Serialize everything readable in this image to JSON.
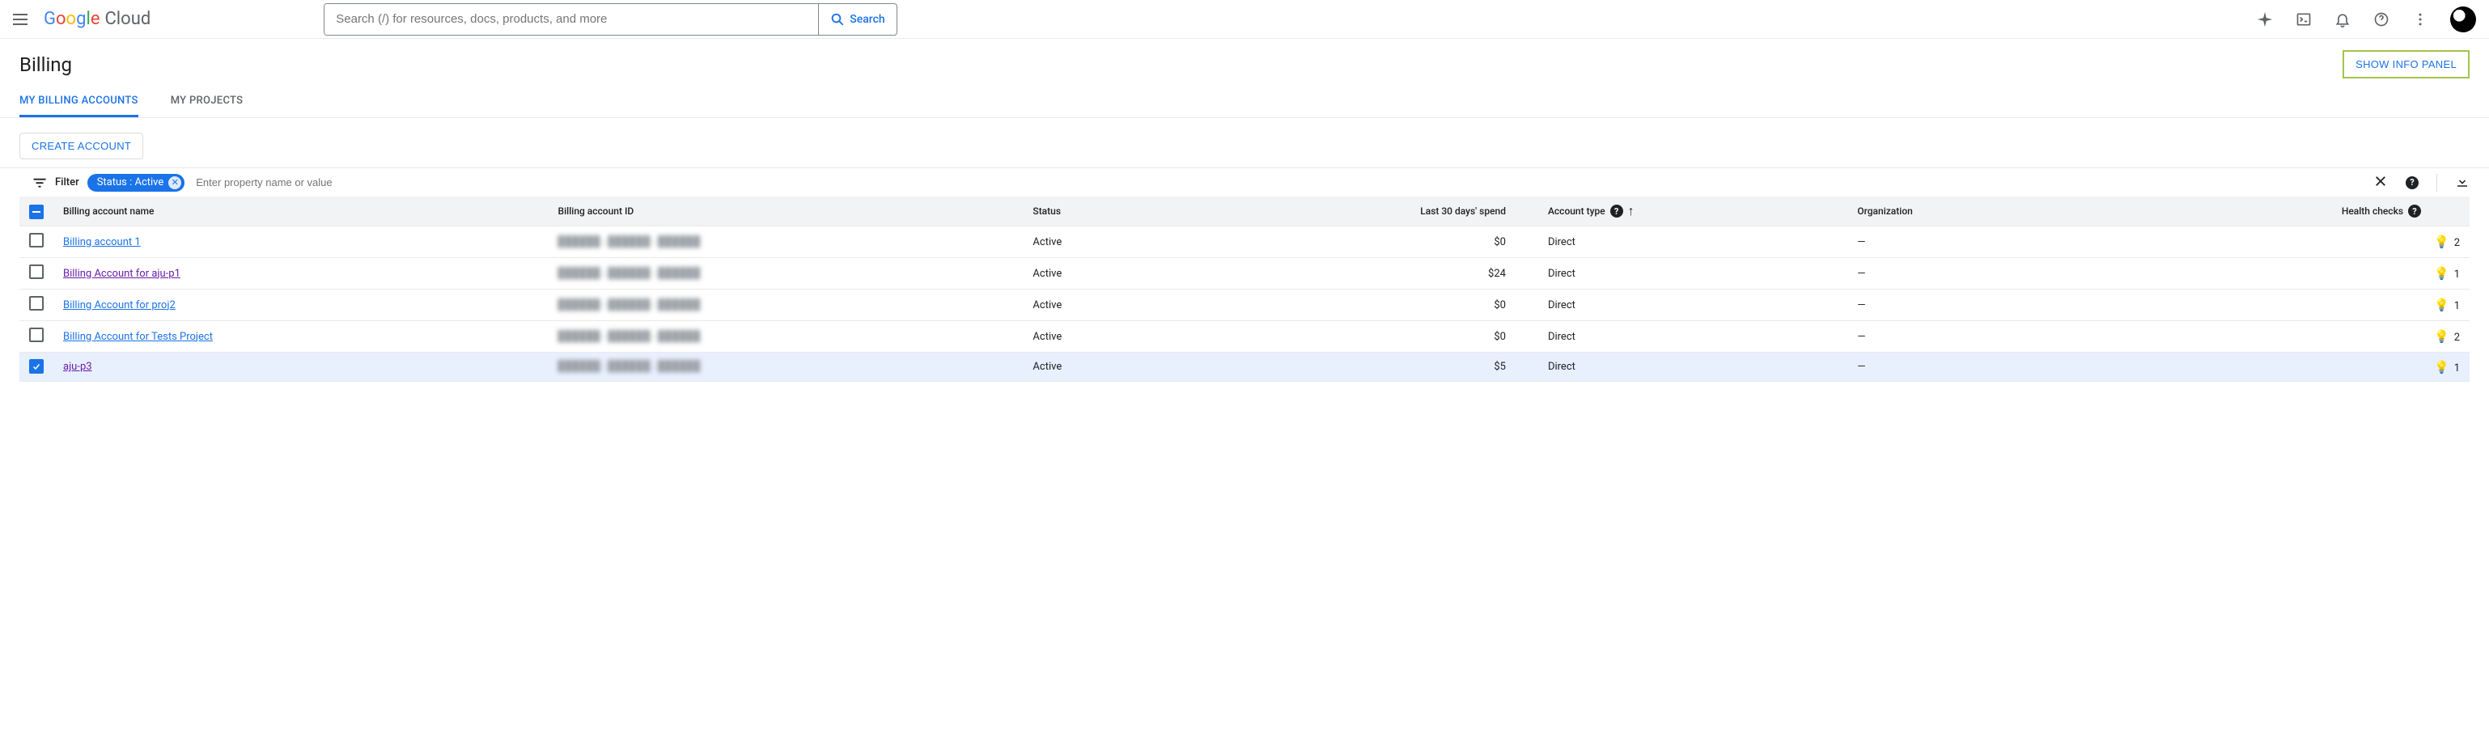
{
  "header": {
    "logo_cloud": "Cloud",
    "search_placeholder": "Search (/) for resources, docs, products, and more",
    "search_button": "Search"
  },
  "page": {
    "title": "Billing",
    "info_panel_button": "SHOW INFO PANEL"
  },
  "tabs": [
    {
      "label": "MY BILLING ACCOUNTS",
      "active": true
    },
    {
      "label": "MY PROJECTS",
      "active": false
    }
  ],
  "actions": {
    "create_account": "CREATE ACCOUNT"
  },
  "filter": {
    "label": "Filter",
    "chip": "Status : Active",
    "input_placeholder": "Enter property name or value"
  },
  "columns": {
    "check": "",
    "name": "Billing account name",
    "id": "Billing account ID",
    "status": "Status",
    "spend": "Last 30 days' spend",
    "type": "Account type",
    "org": "Organization",
    "health": "Health checks"
  },
  "rows": [
    {
      "name": "Billing account 1",
      "id": "██████-██████-██████",
      "status": "Active",
      "spend": "$0",
      "type": "Direct",
      "org": "—",
      "health": "2",
      "checked": false,
      "visited": false
    },
    {
      "name": "Billing Account for aju-p1",
      "id": "██████-██████-██████",
      "status": "Active",
      "spend": "$24",
      "type": "Direct",
      "org": "—",
      "health": "1",
      "checked": false,
      "visited": true
    },
    {
      "name": "Billing Account for proj2",
      "id": "██████-██████-██████",
      "status": "Active",
      "spend": "$0",
      "type": "Direct",
      "org": "—",
      "health": "1",
      "checked": false,
      "visited": false
    },
    {
      "name": "Billing Account for Tests Project",
      "id": "██████-██████-██████",
      "status": "Active",
      "spend": "$0",
      "type": "Direct",
      "org": "—",
      "health": "2",
      "checked": false,
      "visited": false
    },
    {
      "name": "aju-p3",
      "id": "██████-██████-██████",
      "status": "Active",
      "spend": "$5",
      "type": "Direct",
      "org": "—",
      "health": "1",
      "checked": true,
      "visited": true
    }
  ]
}
